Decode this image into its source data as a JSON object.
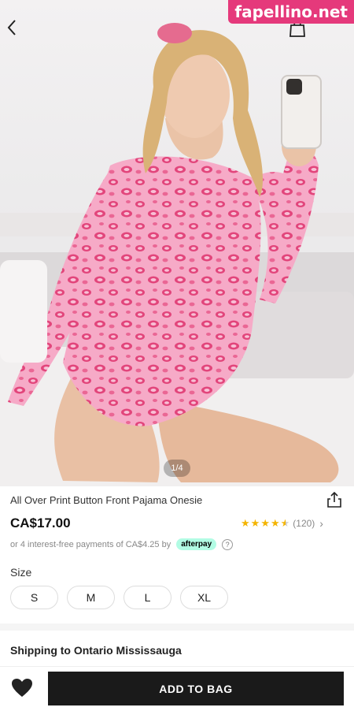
{
  "watermark": "fapellino.net",
  "gallery": {
    "indicator": "1/4"
  },
  "product": {
    "title": "All Over Print Button Front Pajama Onesie",
    "price": "CA$17.00",
    "rating": {
      "stars": 4.5,
      "count": "(120)"
    },
    "installments_text": "or 4 interest-free payments of CA$4.25 by",
    "afterpay_label": "afterpay",
    "help_icon": "?"
  },
  "size": {
    "label": "Size",
    "options": [
      "S",
      "M",
      "L",
      "XL"
    ]
  },
  "shipping": {
    "label": "Shipping to Ontario Mississauga"
  },
  "actions": {
    "add_to_bag": "ADD TO BAG"
  },
  "colors": {
    "accent": "#1a1a1a",
    "star": "#f4b400",
    "afterpay": "#b2fce4",
    "watermark": "#e5397b",
    "leopard_base": "#f6aac7",
    "leopard_spot": "#e2457b"
  },
  "icons": {
    "back": "chevron-left-icon",
    "bag": "shopping-bag-icon",
    "more": "more-horizontal-icon",
    "share": "share-icon",
    "favorite": "heart-icon"
  }
}
